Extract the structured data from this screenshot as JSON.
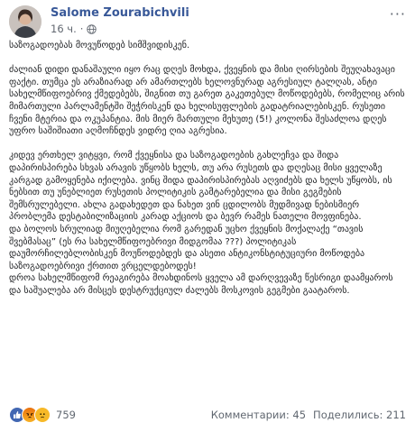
{
  "post": {
    "author": "Salome Zourabichvili",
    "time": "16 ч.",
    "more": "···",
    "paragraphs": [
      "საზოგადოებას მოვუწოდებ სიმშვიდისკენ.",
      "ძალიან დიდი დანაშაული იყო რაც დღეს მოხდა, ქვეყნის და მისი ღირსების შეუღახავაცი ფაქტი. თუმცა ეს არაზიარად არ ამართლებს ხელოვნურად აგრესიულ ტალღას, ანტი სახელმწიფოებრივ ქმედებებს, შიგნით თუ გარეთ გაკეთებულ მოწოდებებს, რომელიც არის მიმართული პარლამენტში შეჭრისკენ და ხელისუფლების გადატრიალებისკენ. რუსეთი ჩვენი მტერია და ოკუპანტია. მის მიერ მართული მეხუთე (5!) კოლონა შესაძლოა დღეს უფრო საშიშიათი აღმოჩნდეს ვიდრე ღია აგრესია.",
      "კიდევ ერთხელ ვიტყვი, რომ ქვეყნისა და საზოგადოების გახლეჩვა და შიდა დაპირისპირება სხვას არავის უწყობს ხელს, თუ არა რუსეთს და დღესაც მისი ყველაზე კარგად გამოყენება იქილება. ვინც შიდა დაპირისპირებას აღვიძებს და ხელს უწყობს, ის ნებსით თუ უნებლიეთ რუსეთის პოლიტიკის გამტარებელია და მისი გეგმების შემსრულებელი. ახლა გადახედეთ და ნახეთ ვინ ცდილობს მუდმივად ნებისმიერ პრობლემა დესტაბილიზაციის კარად აქციოს და ბევრ რამეს ნათელი მოვფინება.",
      "და ბოლოს სრულიად მიუღებელია რომ გარედან უცხო ქვეყნის მოქალაქე “თავის შვებმასაც” (ეს რა სახელმწიფოებრივი მიდგომაა ???) პოლიტიკას დაუმორჩილებლობისკენ მოუწოდებდეს და ასეთი ანტიკონსტიტუციური მოწოდება საზოგადოებრივი ქრთით ვრცელდებოდეს!",
      "დროა სახელმწიფომ რეაგირება მოახდინოს ყველა ამ დარღვევაზე წესრიგი დაამყაროს და საშუალება არ მისცეს დესტრუქციულ ძალებს მოსკოვის გეგმები გაატაროს."
    ]
  },
  "footer": {
    "reaction_count": "759",
    "comments_label": "Комментарии: 45",
    "shares_label": "Поделились: 211"
  },
  "colors": {
    "author": "#385898",
    "meta": "#616770",
    "like": "#4267b2",
    "angry": "#e9710f",
    "sad": "#f7b928"
  }
}
